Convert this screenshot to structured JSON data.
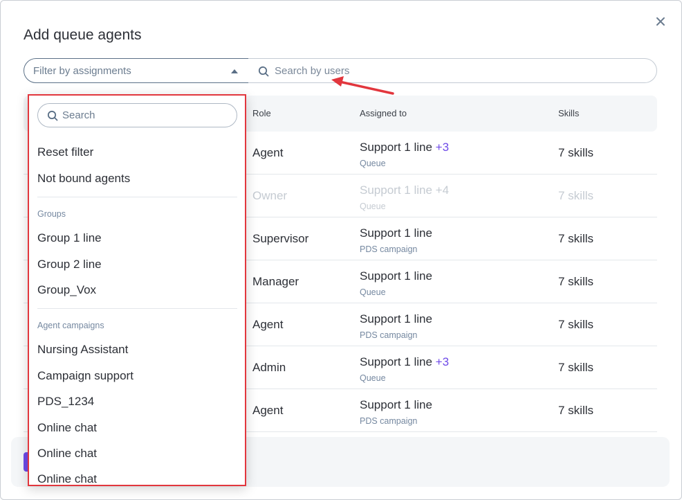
{
  "dialog": {
    "title": "Add queue agents"
  },
  "filter": {
    "placeholder": "Filter by assignments"
  },
  "search_users": {
    "placeholder": "Search by users"
  },
  "table": {
    "headers": {
      "role": "Role",
      "assigned_to": "Assigned to",
      "skills": "Skills"
    },
    "rows": [
      {
        "role": "Agent",
        "assigned": "Support 1 line",
        "extra": "+3",
        "type": "Queue",
        "skills": "7 skills",
        "disabled": false
      },
      {
        "role": "Owner",
        "assigned": "Support 1 line",
        "extra": "+4",
        "type": "Queue",
        "skills": "7 skills",
        "disabled": true
      },
      {
        "role": "Supervisor",
        "assigned": "Support 1 line",
        "extra": "",
        "type": "PDS campaign",
        "skills": "7 skills",
        "disabled": false
      },
      {
        "role": "Manager",
        "assigned": "Support 1 line",
        "extra": "",
        "type": "Queue",
        "skills": "7 skills",
        "disabled": false
      },
      {
        "role": "Agent",
        "assigned": "Support 1 line",
        "extra": "",
        "type": "PDS campaign",
        "skills": "7 skills",
        "disabled": false
      },
      {
        "role": "Admin",
        "assigned": "Support 1 line",
        "extra": "+3",
        "type": "Queue",
        "skills": "7 skills",
        "disabled": false
      },
      {
        "role": "Agent",
        "assigned": "Support 1 line",
        "extra": "",
        "type": "PDS campaign",
        "skills": "7 skills",
        "disabled": false
      }
    ]
  },
  "dropdown": {
    "search_placeholder": "Search",
    "reset": "Reset filter",
    "not_bound": "Not bound agents",
    "groups_label": "Groups",
    "groups": [
      "Group 1 line",
      "Group 2 line",
      "Group_Vox"
    ],
    "campaigns_label": "Agent campaigns",
    "campaigns": [
      "Nursing Assistant",
      "Campaign support",
      "PDS_1234",
      "Online chat",
      "Online chat",
      "Online chat"
    ]
  },
  "colors": {
    "accent": "#6e4ae8",
    "highlight": "#e2363d",
    "arrow": "#e2363d"
  },
  "icons": [
    "close-icon",
    "search-icon",
    "caret-up-icon",
    "arrow-annotation-icon"
  ]
}
